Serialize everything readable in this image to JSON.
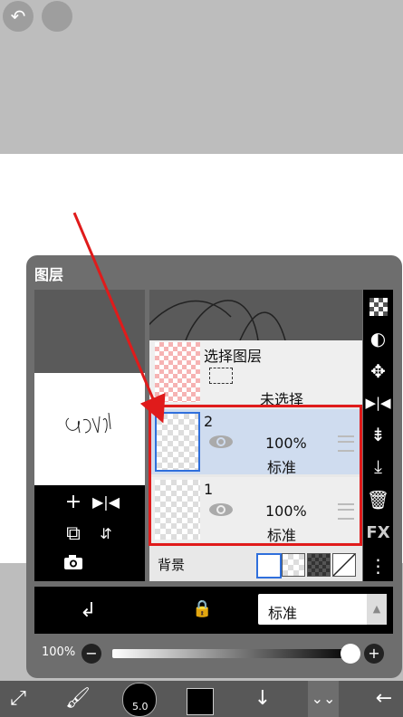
{
  "panel": {
    "title": "图层"
  },
  "selection_layer": {
    "label": "选择图层",
    "status": "未选择"
  },
  "layers": [
    {
      "name": "2",
      "opacity": "100%",
      "blend": "标准",
      "selected": true
    },
    {
      "name": "1",
      "opacity": "100%",
      "blend": "标准",
      "selected": false
    }
  ],
  "background": {
    "label": "背景"
  },
  "blend_mode": {
    "value": "标准"
  },
  "opacity": {
    "label": "100%",
    "value": 0.97
  },
  "brush": {
    "size": "5.0"
  },
  "side_tools": {
    "fx_label": "FX"
  },
  "colors": {
    "highlight": "#e01b1b",
    "selected_row": "#cfdcef"
  }
}
